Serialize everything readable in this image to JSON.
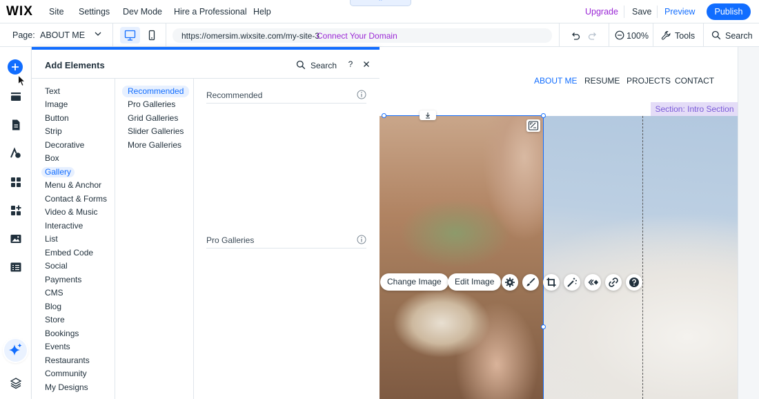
{
  "topbar": {
    "logo": "WIX",
    "menu": [
      "Site",
      "Settings",
      "Dev Mode",
      "Hire a Professional",
      "Help"
    ],
    "upgrade": "Upgrade",
    "save": "Save",
    "preview": "Preview",
    "publish": "Publish"
  },
  "secbar": {
    "page_label": "Page:",
    "page_name": "ABOUT ME",
    "url": "https://omersim.wixsite.com/my-site-3",
    "connect": "Connect Your Domain",
    "zoom": "100%",
    "tools": "Tools",
    "search": "Search"
  },
  "panel": {
    "title": "Add Elements",
    "search": "Search",
    "help": "?",
    "categories": [
      "Text",
      "Image",
      "Button",
      "Strip",
      "Decorative",
      "Box",
      "Gallery",
      "Menu & Anchor",
      "Contact & Forms",
      "Video & Music",
      "Interactive",
      "List",
      "Embed Code",
      "Social",
      "Payments",
      "CMS",
      "Blog",
      "Store",
      "Bookings",
      "Events",
      "Restaurants",
      "Community",
      "My Designs"
    ],
    "active_category": "Gallery",
    "subcategories": [
      "Recommended",
      "Pro Galleries",
      "Grid Galleries",
      "Slider Galleries",
      "More Galleries"
    ],
    "active_subcategory": "Recommended",
    "sections": [
      "Recommended",
      "Pro Galleries"
    ]
  },
  "canvas": {
    "nav": [
      "ABOUT ME",
      "RESUME",
      "PROJECTS",
      "CONTACT"
    ],
    "active_nav": "ABOUT ME",
    "section_tag": "Section: Intro Section",
    "change_image": "Change Image",
    "edit_image": "Edit Image"
  },
  "colors": {
    "accent": "#116dff",
    "upgrade": "#9a27d5",
    "active_bg": "#e7f0ff",
    "section_tag_bg": "#e4dcf7"
  }
}
